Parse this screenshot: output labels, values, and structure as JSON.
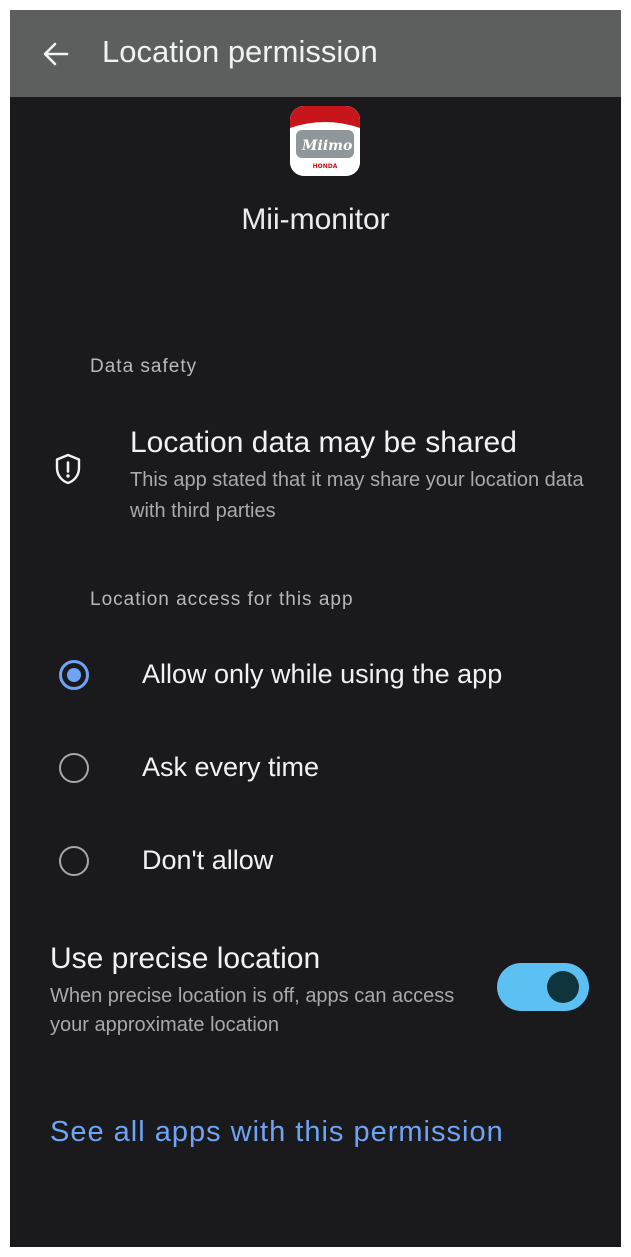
{
  "colors": {
    "background": "#1a1a1c",
    "header_bar": "#5c5f5e",
    "accent": "#6ea3f5",
    "toggle_track": "#5cc0f2"
  },
  "header": {
    "back_icon": "arrow-left-icon",
    "title": "Location permission"
  },
  "app": {
    "icon": "app-icon",
    "name": "Mii-monitor",
    "icon_text_primary": "Miimo",
    "icon_text_secondary": "HONDA"
  },
  "data_safety": {
    "header": "Data safety",
    "icon": "shield-alert-icon",
    "title": "Location data may be shared",
    "description": "This app stated that it may share your location data with third parties"
  },
  "location_access": {
    "header": "Location access for this app",
    "options": [
      {
        "label": "Allow only while using the app",
        "selected": true
      },
      {
        "label": "Ask every time",
        "selected": false
      },
      {
        "label": "Don't allow",
        "selected": false
      }
    ]
  },
  "precise_location": {
    "title": "Use precise location",
    "description": "When precise location is off, apps can access your approximate location",
    "enabled": true
  },
  "footer_link": {
    "label": "See all apps with this permission"
  }
}
